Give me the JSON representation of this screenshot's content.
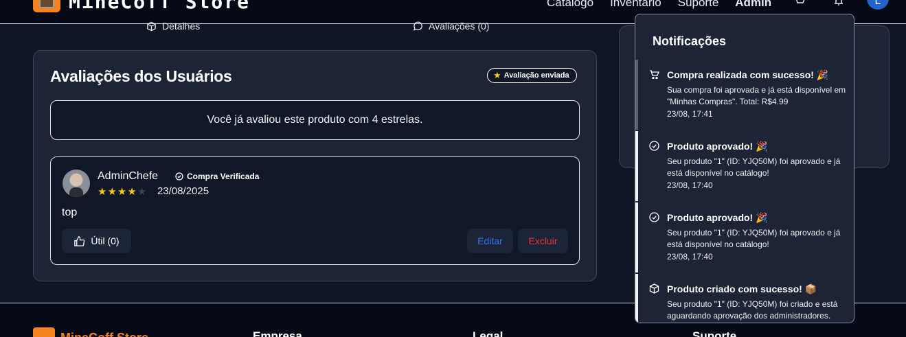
{
  "nav": {
    "brand": "MineCoff Store",
    "links": [
      "Catálogo",
      "Inventário",
      "Suporte",
      "Admin"
    ],
    "avatar_initial": "L"
  },
  "tabs": {
    "details": "Detalhes",
    "reviews": "Avaliações (0)"
  },
  "reviews_panel": {
    "title": "Avaliações dos Usuários",
    "badge": "Avaliação enviada",
    "notice": "Você já avaliou este produto com 4 estrelas.",
    "review": {
      "author": "AdminChefe",
      "verified": "Compra Verificada",
      "rating": 4,
      "rating_max": 5,
      "date": "23/08/2025",
      "text": "top",
      "helpful_label": "Útil (0)",
      "edit_label": "Editar",
      "delete_label": "Excluir"
    }
  },
  "notifications": {
    "title": "Notificações",
    "items": [
      {
        "icon": "cart-icon",
        "title": "Compra realizada com sucesso! 🎉",
        "body": "Sua compra foi aprovada e já está disponível em \"Minhas Compras\". Total: R$4.99",
        "time": "23/08, 17:41",
        "read": true
      },
      {
        "icon": "check-circle-icon",
        "title": "Produto aprovado! 🎉",
        "body": "Seu produto \"1\" (ID: YJQ50M) foi aprovado e já está disponível no catálogo!",
        "time": "23/08, 17:40",
        "read": false
      },
      {
        "icon": "check-circle-icon",
        "title": "Produto aprovado! 🎉",
        "body": "Seu produto \"1\" (ID: YJQ50M) foi aprovado e já está disponível no catálogo!",
        "time": "23/08, 17:40",
        "read": false
      },
      {
        "icon": "box-icon",
        "title": "Produto criado com sucesso! 📦",
        "body": "Seu produto \"1\" (ID: YJQ50M) foi criado e está aguardando aprovação dos administradores.",
        "time": "",
        "read": false
      }
    ]
  },
  "footer": {
    "brand": "MineCoff Store",
    "columns": [
      "Empresa",
      "Legal",
      "Suporte"
    ]
  },
  "colors": {
    "accent": "#f5821f",
    "star": "#f5c518",
    "edit": "#3b6ff0",
    "delete": "#e0343a"
  }
}
